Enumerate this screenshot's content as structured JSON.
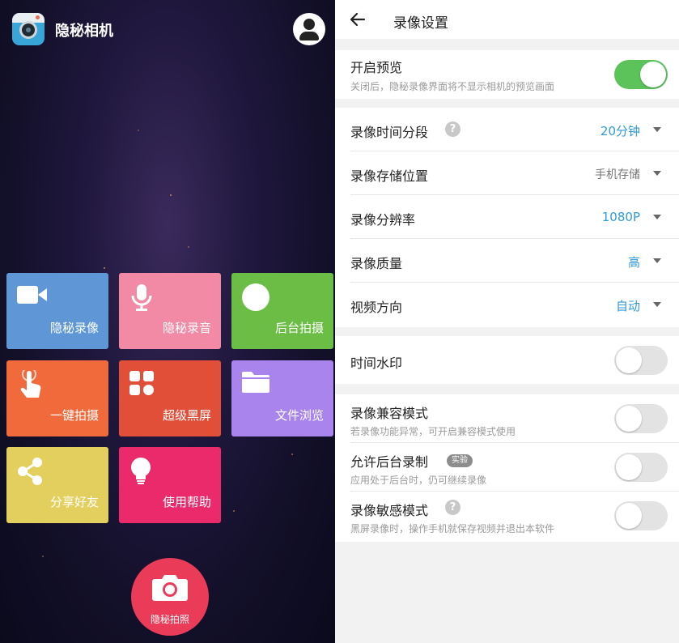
{
  "app": {
    "title": "隐秘相机"
  },
  "tiles": [
    {
      "label": "隐秘录像",
      "color": "#5f97d6",
      "icon": "video-camera-icon"
    },
    {
      "label": "隐秘录音",
      "color": "#f28aa5",
      "icon": "microphone-icon"
    },
    {
      "label": "后台拍摄",
      "color": "#6bbd45",
      "icon": "circle-icon"
    },
    {
      "label": "一键拍摄",
      "color": "#f06a3c",
      "icon": "tap-hand-icon"
    },
    {
      "label": "超级黑屏",
      "color": "#e24f39",
      "icon": "grid-icon"
    },
    {
      "label": "文件浏览",
      "color": "#a884ec",
      "icon": "folder-icon"
    },
    {
      "label": "分享好友",
      "color": "#e3cf5d",
      "icon": "share-icon"
    },
    {
      "label": "使用帮助",
      "color": "#ea2a6b",
      "icon": "lightbulb-icon"
    }
  ],
  "shutter": {
    "label": "隐秘拍照",
    "color": "#ea3c59"
  },
  "settings": {
    "title": "录像设置",
    "preview": {
      "label": "开启预览",
      "desc": "关闭后，隐秘录像界面将不显示相机的预览画面",
      "enabled": true
    },
    "segment": {
      "label": "录像时间分段",
      "value": "20分钟"
    },
    "storage": {
      "label": "录像存储位置",
      "value": "手机存储"
    },
    "resolution": {
      "label": "录像分辨率",
      "value": "1080P"
    },
    "quality": {
      "label": "录像质量",
      "value": "高"
    },
    "orientation": {
      "label": "视频方向",
      "value": "自动"
    },
    "watermark": {
      "label": "时间水印",
      "enabled": false
    },
    "compat": {
      "label": "录像兼容模式",
      "desc": "若录像功能异常，可开启兼容模式使用",
      "enabled": false
    },
    "background": {
      "label": "允许后台录制",
      "badge": "实验",
      "desc": "应用处于后台时，仍可继续录像",
      "enabled": false
    },
    "sensitive": {
      "label": "录像敏感模式",
      "desc": "黑屏录像时，操作手机就保存视频并退出本软件",
      "enabled": false
    }
  },
  "colors": {
    "accent": "#2f9ad9",
    "toggle_on": "#5cc35b",
    "muted_value": "#777777"
  }
}
